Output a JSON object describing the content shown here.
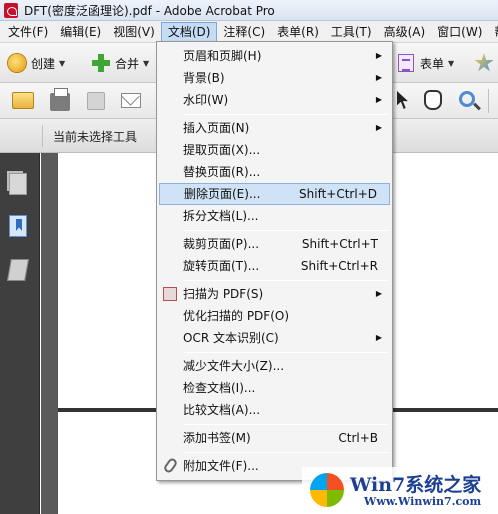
{
  "window": {
    "title": "DFT(密度泛函理论).pdf - Adobe Acrobat Pro"
  },
  "menubar": [
    {
      "label": "文件(F)"
    },
    {
      "label": "编辑(E)"
    },
    {
      "label": "视图(V)"
    },
    {
      "label": "文档(D)",
      "active": true
    },
    {
      "label": "注释(C)"
    },
    {
      "label": "表单(R)"
    },
    {
      "label": "工具(T)"
    },
    {
      "label": "高级(A)"
    },
    {
      "label": "窗口(W)"
    },
    {
      "label": "帮"
    }
  ],
  "toolbar1": {
    "create": "创建",
    "merge": "合并",
    "forms": "表单"
  },
  "toolbar3": {
    "tools_status": "当前未选择工具"
  },
  "document_menu": {
    "header_page": "页眉和页脚(H)",
    "background": "背景(B)",
    "watermark": "水印(W)",
    "insert_pages": "插入页面(N)",
    "extract_pages": "提取页面(X)...",
    "replace_pages": "替换页面(R)...",
    "delete_pages": "删除页面(E)...",
    "delete_shortcut": "Shift+Ctrl+D",
    "split_document": "拆分文档(L)...",
    "crop_pages": "裁剪页面(P)...",
    "crop_shortcut": "Shift+Ctrl+T",
    "rotate_pages": "旋转页面(T)...",
    "rotate_shortcut": "Shift+Ctrl+R",
    "scan_to_pdf": "扫描为 PDF(S)",
    "optimize_scan": "优化扫描的 PDF(O)",
    "ocr": "OCR 文本识别(C)",
    "reduce_size": "减少文件大小(Z)...",
    "examine": "检查文档(I)...",
    "compare": "比较文档(A)...",
    "add_bookmark": "添加书签(M)",
    "bookmark_shortcut": "Ctrl+B",
    "attach_file": "附加文件(F)..."
  },
  "watermark_overlay": {
    "title": "Win7系统之家",
    "url": "Www.Winwin7.com"
  },
  "colors": {
    "menu_highlight": "#cfe2f6",
    "rail": "#3f3f3f",
    "brand_blue": "#1c3f94"
  }
}
